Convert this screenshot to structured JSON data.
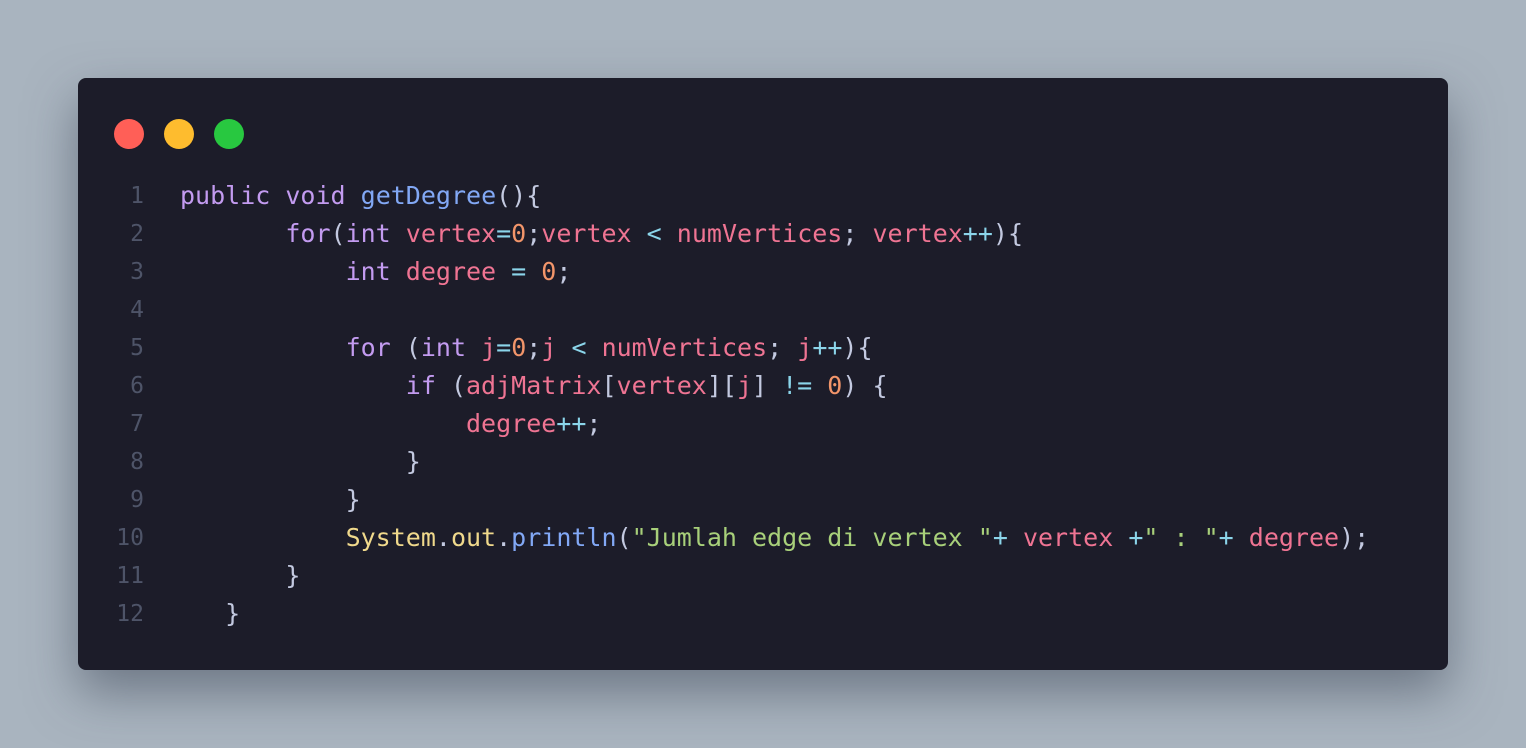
{
  "window_controls": {
    "close": "close",
    "minimize": "minimize",
    "maximize": "maximize",
    "colors": {
      "close": "#ff5f57",
      "minimize": "#febc2e",
      "maximize": "#28c840"
    }
  },
  "colors": {
    "background": "#a9b4bf",
    "editor": "#1c1c29",
    "keyword": "#c39bf0",
    "function": "#82a8f5",
    "variable": "#ef7493",
    "number": "#f2956a",
    "operator": "#8bd5ea",
    "class": "#f0d98c",
    "string": "#a8d07a",
    "line_number": "#4e5468"
  },
  "code": {
    "lines": [
      {
        "n": "1",
        "indent": "",
        "tokens": [
          [
            "kw",
            "public"
          ],
          [
            "pun",
            " "
          ],
          [
            "kw",
            "void"
          ],
          [
            "pun",
            " "
          ],
          [
            "fn",
            "getDegree"
          ],
          [
            "pun",
            "(){"
          ]
        ]
      },
      {
        "n": "2",
        "indent": "       ",
        "tokens": [
          [
            "kw",
            "for"
          ],
          [
            "pun",
            "("
          ],
          [
            "kw",
            "int"
          ],
          [
            "pun",
            " "
          ],
          [
            "var",
            "vertex"
          ],
          [
            "op",
            "="
          ],
          [
            "num",
            "0"
          ],
          [
            "pun",
            ";"
          ],
          [
            "var",
            "vertex"
          ],
          [
            "pun",
            " "
          ],
          [
            "op",
            "<"
          ],
          [
            "pun",
            " "
          ],
          [
            "var",
            "numVertices"
          ],
          [
            "pun",
            "; "
          ],
          [
            "var",
            "vertex"
          ],
          [
            "op",
            "++"
          ],
          [
            "pun",
            "){"
          ]
        ]
      },
      {
        "n": "3",
        "indent": "           ",
        "tokens": [
          [
            "kw",
            "int"
          ],
          [
            "pun",
            " "
          ],
          [
            "var",
            "degree"
          ],
          [
            "pun",
            " "
          ],
          [
            "op",
            "="
          ],
          [
            "pun",
            " "
          ],
          [
            "num",
            "0"
          ],
          [
            "pun",
            ";"
          ]
        ]
      },
      {
        "n": "4",
        "indent": "",
        "tokens": []
      },
      {
        "n": "5",
        "indent": "           ",
        "tokens": [
          [
            "kw",
            "for"
          ],
          [
            "pun",
            " ("
          ],
          [
            "kw",
            "int"
          ],
          [
            "pun",
            " "
          ],
          [
            "var",
            "j"
          ],
          [
            "op",
            "="
          ],
          [
            "num",
            "0"
          ],
          [
            "pun",
            ";"
          ],
          [
            "var",
            "j"
          ],
          [
            "pun",
            " "
          ],
          [
            "op",
            "<"
          ],
          [
            "pun",
            " "
          ],
          [
            "var",
            "numVertices"
          ],
          [
            "pun",
            "; "
          ],
          [
            "var",
            "j"
          ],
          [
            "op",
            "++"
          ],
          [
            "pun",
            "){"
          ]
        ]
      },
      {
        "n": "6",
        "indent": "               ",
        "tokens": [
          [
            "kw",
            "if"
          ],
          [
            "pun",
            " ("
          ],
          [
            "var",
            "adjMatrix"
          ],
          [
            "pun",
            "["
          ],
          [
            "var",
            "vertex"
          ],
          [
            "pun",
            "]["
          ],
          [
            "var",
            "j"
          ],
          [
            "pun",
            "] "
          ],
          [
            "op",
            "!="
          ],
          [
            "pun",
            " "
          ],
          [
            "num",
            "0"
          ],
          [
            "pun",
            ") {"
          ]
        ]
      },
      {
        "n": "7",
        "indent": "                   ",
        "tokens": [
          [
            "var",
            "degree"
          ],
          [
            "op",
            "++"
          ],
          [
            "pun",
            ";"
          ]
        ]
      },
      {
        "n": "8",
        "indent": "               ",
        "tokens": [
          [
            "pun",
            "}"
          ]
        ]
      },
      {
        "n": "9",
        "indent": "           ",
        "tokens": [
          [
            "pun",
            "}"
          ]
        ]
      },
      {
        "n": "10",
        "indent": "           ",
        "tokens": [
          [
            "cls",
            "System"
          ],
          [
            "pun",
            "."
          ],
          [
            "cls",
            "out"
          ],
          [
            "pun",
            "."
          ],
          [
            "fn",
            "println"
          ],
          [
            "pun",
            "("
          ],
          [
            "str",
            "\"Jumlah edge di vertex \""
          ],
          [
            "op",
            "+"
          ],
          [
            "pun",
            " "
          ],
          [
            "var",
            "vertex"
          ],
          [
            "pun",
            " "
          ],
          [
            "op",
            "+"
          ],
          [
            "str",
            "\" : \""
          ],
          [
            "op",
            "+"
          ],
          [
            "pun",
            " "
          ],
          [
            "var",
            "degree"
          ],
          [
            "pun",
            ");"
          ]
        ]
      },
      {
        "n": "11",
        "indent": "       ",
        "tokens": [
          [
            "pun",
            "}"
          ]
        ]
      },
      {
        "n": "12",
        "indent": "   ",
        "tokens": [
          [
            "pun",
            "}"
          ]
        ]
      }
    ]
  }
}
